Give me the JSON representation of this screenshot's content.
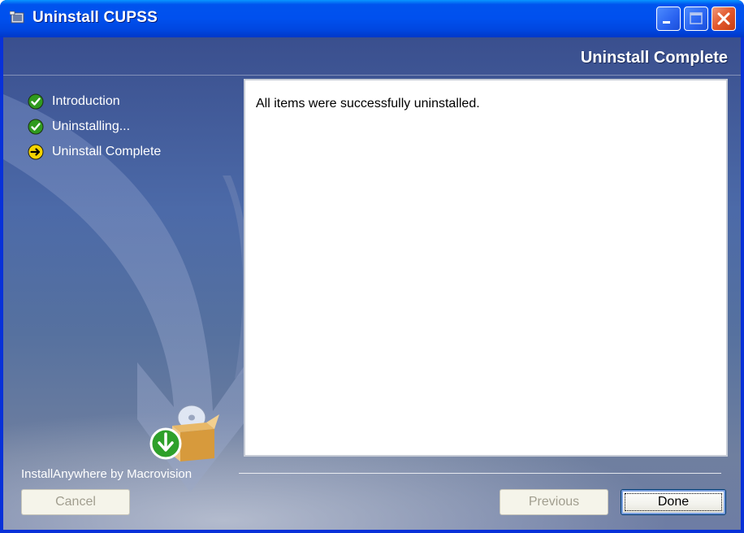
{
  "window": {
    "title": "Uninstall CUPSS"
  },
  "header": {
    "title": "Uninstall Complete"
  },
  "steps": [
    {
      "label": "Introduction",
      "status": "done"
    },
    {
      "label": "Uninstalling...",
      "status": "done"
    },
    {
      "label": "Uninstall Complete",
      "status": "current"
    }
  ],
  "content": {
    "message": "All items were successfully uninstalled."
  },
  "footer": {
    "brand": "InstallAnywhere by Macrovision",
    "cancel_label": "Cancel",
    "previous_label": "Previous",
    "done_label": "Done"
  },
  "colors": {
    "titlebar": "#0050ee",
    "panel_bg": "#4c6aa8",
    "step_done": "#2f9a1e",
    "step_current": "#f5d400"
  },
  "icons": {
    "app": "installer-icon",
    "done_step": "check-circle-icon",
    "current_step": "arrow-right-circle-icon",
    "product": "box-with-disc-icon"
  }
}
